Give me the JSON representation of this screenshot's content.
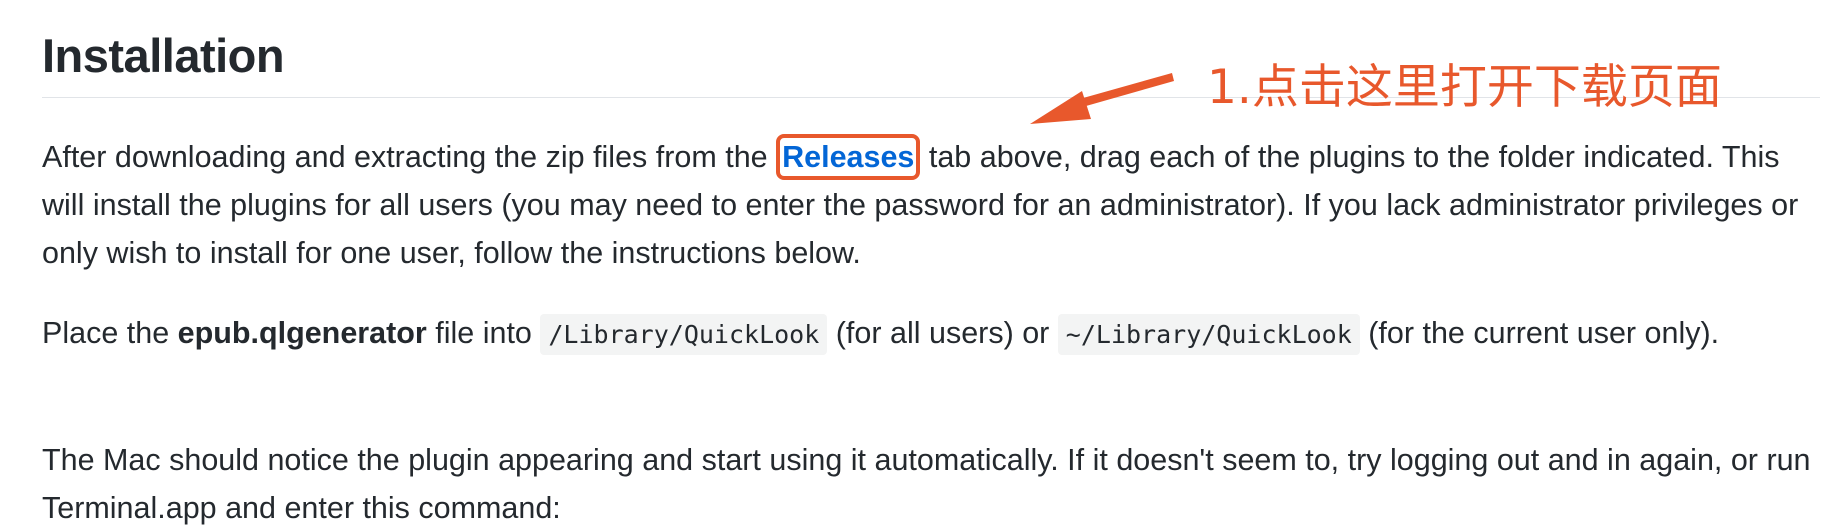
{
  "heading": "Installation",
  "annotation": {
    "text": "1.点击这里打开下载页面",
    "color": "#e8582c"
  },
  "para1": {
    "before": "After downloading and extracting the zip files from the ",
    "link": "Releases",
    "after": " tab above, drag each of the plugins to the folder indicated. This will install the plugins for all users (you may need to enter the password for an administrator). If you lack administrator privileges or only wish to install for one user, follow the instructions below."
  },
  "para2": {
    "t1": "Place the ",
    "bold": "epub.qlgenerator",
    "t2": " file into ",
    "code1": "/Library/QuickLook",
    "t3": " (for all users) or ",
    "code2": "~/Library/QuickLook",
    "t4": " (for the current user only)."
  },
  "para3": {
    "text": "The Mac should notice the plugin appearing and start using it automatically. If it doesn't seem to, try logging out and in again, or run Terminal.app and enter this command:"
  },
  "colors": {
    "link": "#0366d6",
    "text": "#24292e",
    "accent": "#e8582c"
  }
}
